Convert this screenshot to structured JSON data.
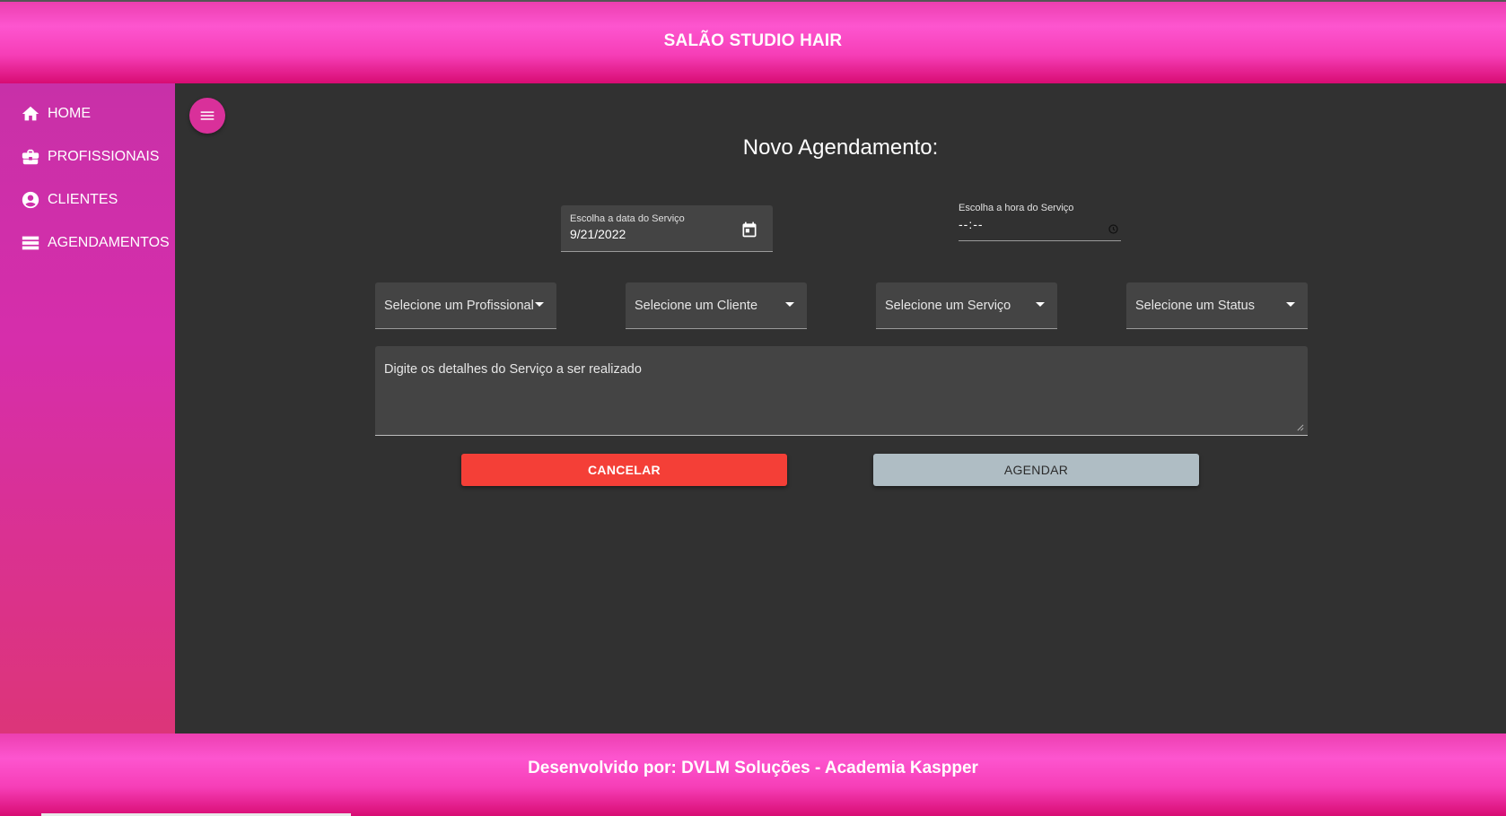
{
  "header": {
    "title": "SALÃO STUDIO HAIR"
  },
  "sidebar": {
    "items": [
      {
        "label": "HOME",
        "icon": "home-icon"
      },
      {
        "label": "PROFISSIONAIS",
        "icon": "briefcase-icon"
      },
      {
        "label": "CLIENTES",
        "icon": "account-circle-icon"
      },
      {
        "label": "AGENDAMENTOS",
        "icon": "storage-icon"
      }
    ]
  },
  "main": {
    "title": "Novo Agendamento:",
    "date_field": {
      "label": "Escolha a data do Serviço",
      "value": "9/21/2022"
    },
    "time_field": {
      "label": "Escolha a hora do Serviço",
      "value": "--:--"
    },
    "selects": [
      {
        "label": "Selecione um Profissional"
      },
      {
        "label": "Selecione um Cliente"
      },
      {
        "label": "Selecione um Serviço"
      },
      {
        "label": "Selecione um Status"
      }
    ],
    "details": {
      "placeholder": "Digite os detalhes do Serviço a ser realizado"
    },
    "buttons": {
      "cancel": "CANCELAR",
      "submit": "AGENDAR"
    }
  },
  "footer": {
    "text": "Desenvolvido por: DVLM Soluções - Academia Kaspper"
  },
  "colors": {
    "brand_pink": "#fd55cf",
    "cancel_red": "#f43f37",
    "submit_gray": "#afbdc4",
    "main_bg": "#313131",
    "field_bg": "#444444"
  }
}
